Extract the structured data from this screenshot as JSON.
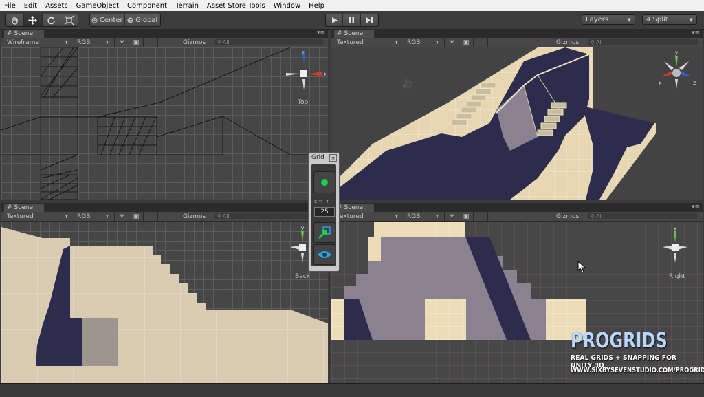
{
  "menu": [
    "File",
    "Edit",
    "Assets",
    "GameObject",
    "Component",
    "Terrain",
    "Asset Store Tools",
    "Window",
    "Help"
  ],
  "toolbar": {
    "tools": [
      "hand-icon",
      "move-icon",
      "rotate-icon",
      "scale-icon"
    ],
    "pivot_label": "Center",
    "space_label": "Global",
    "play_icons": [
      "play-icon",
      "pause-icon",
      "step-icon"
    ],
    "layers_label": "Layers",
    "layout_label": "4 Split"
  },
  "views": {
    "top_left": {
      "tab": "Scene",
      "render": "Wireframe",
      "color": "RGB",
      "gizmos": "Gizmos",
      "search": "All",
      "orientation": "Top",
      "axes": {
        "a": "z",
        "b": "x"
      }
    },
    "top_right": {
      "tab": "Scene",
      "render": "Textured",
      "color": "RGB",
      "gizmos": "Gizmos",
      "search": "All",
      "axes": {
        "a": "y",
        "b": "z",
        "c": "x"
      }
    },
    "bottom_left": {
      "tab": "Scene",
      "render": "Textured",
      "color": "RGB",
      "gizmos": "Gizmos",
      "search": "All",
      "orientation": "Back",
      "axes": {
        "a": "y"
      }
    },
    "bottom_right": {
      "tab": "Scene",
      "render": "Textured",
      "color": "RGB",
      "gizmos": "Gizmos",
      "search": "All",
      "orientation": "Right",
      "axes": {
        "a": "y"
      }
    }
  },
  "grid_panel": {
    "title": "Grid",
    "unit": "cm",
    "size": "25"
  },
  "branding": {
    "title": "PROGRIDS",
    "subtitle": "REAL GRIDS + SNAPPING FOR UNITY 3D",
    "url": "WWW.SIXBYSEVENSTUDIO.COM/PROGRIDS"
  },
  "colors": {
    "beige": "#e8d9b8",
    "navy": "#2e2c4c",
    "mauve": "#8a8291",
    "axis_red": "#d83a2a",
    "axis_green": "#6cc24a",
    "axis_blue": "#2d63d4"
  }
}
